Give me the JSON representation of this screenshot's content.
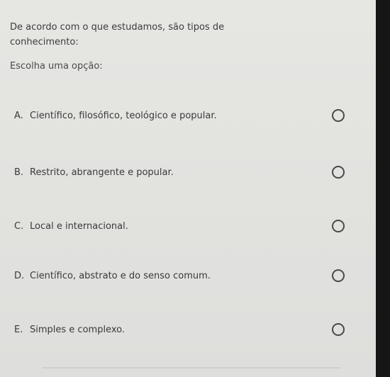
{
  "question": {
    "text": "De acordo com o que estudamos, são tipos de conhecimento:",
    "prompt": "Escolha uma opção:"
  },
  "options": [
    {
      "letter": "A.",
      "label": "Científico, filosófico, teológico e popular."
    },
    {
      "letter": "B.",
      "label": "Restrito, abrangente e popular."
    },
    {
      "letter": "C.",
      "label": "Local e internacional."
    },
    {
      "letter": "D.",
      "label": "Científico, abstrato e do senso comum."
    },
    {
      "letter": "E.",
      "label": "Simples e complexo."
    }
  ]
}
